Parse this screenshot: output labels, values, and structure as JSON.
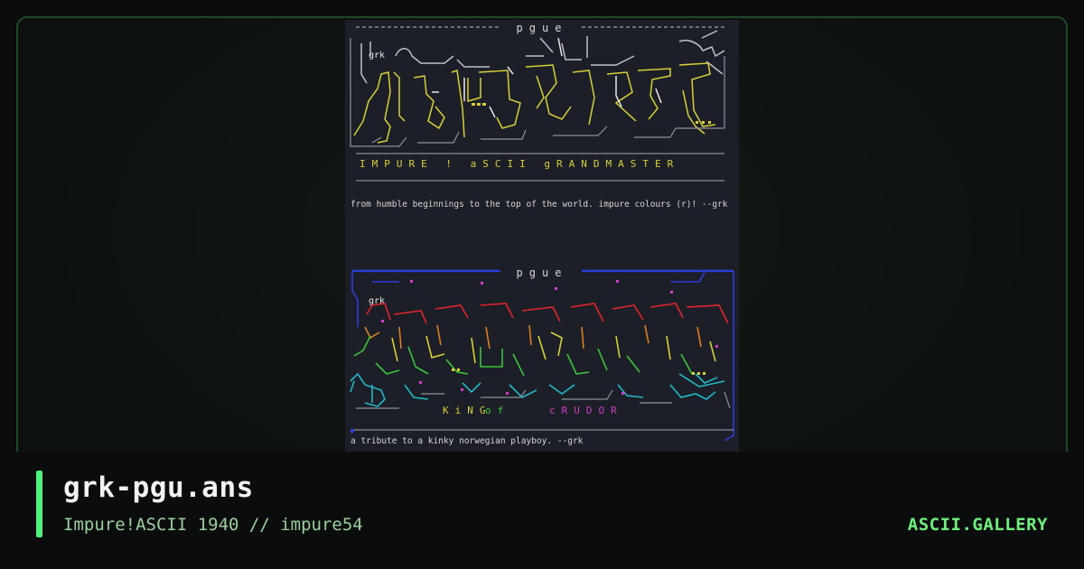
{
  "artwork": {
    "section1": {
      "header": "pgue",
      "tag": "grk",
      "tagline": "IMPURE ! aSCII gRANDMASTER",
      "caption": "from humble beginnings to the top of the world. impure colours (r)! --grk"
    },
    "section2": {
      "header": "pgue",
      "tag": "grk",
      "tagline_part1": "KiNG",
      "tagline_part2": "of",
      "tagline_part3": "cRUDOR",
      "caption": "a tribute to a kinky norwegian playboy. --grk"
    }
  },
  "card": {
    "title": "grk-pgu.ans",
    "subtitle": "Impure!ASCII 1940 // impure54",
    "brand": "ASCII.GALLERY"
  },
  "colors": {
    "accent": "#4ef07a",
    "brand": "#6ff07d",
    "frame_border": "#1f4a2a",
    "art_background": "#1c1f28"
  }
}
